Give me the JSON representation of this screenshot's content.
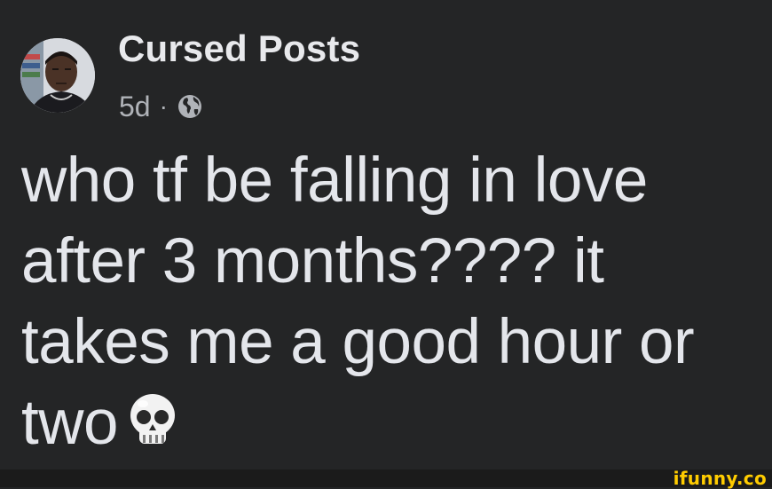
{
  "post": {
    "author_name": "Cursed Posts",
    "timestamp": "5d",
    "separator": "·",
    "privacy_icon": "globe-icon",
    "text_lines": [
      "who tf be falling in love",
      "after 3 months???? it",
      "takes me a good hour or",
      "two"
    ],
    "emoji": "skull-emoji"
  },
  "watermark": {
    "text": "ifunny.co",
    "color": "#ffcc00"
  },
  "colors": {
    "background": "#242526",
    "text": "#e4e6eb",
    "meta": "#b0b3b8"
  }
}
